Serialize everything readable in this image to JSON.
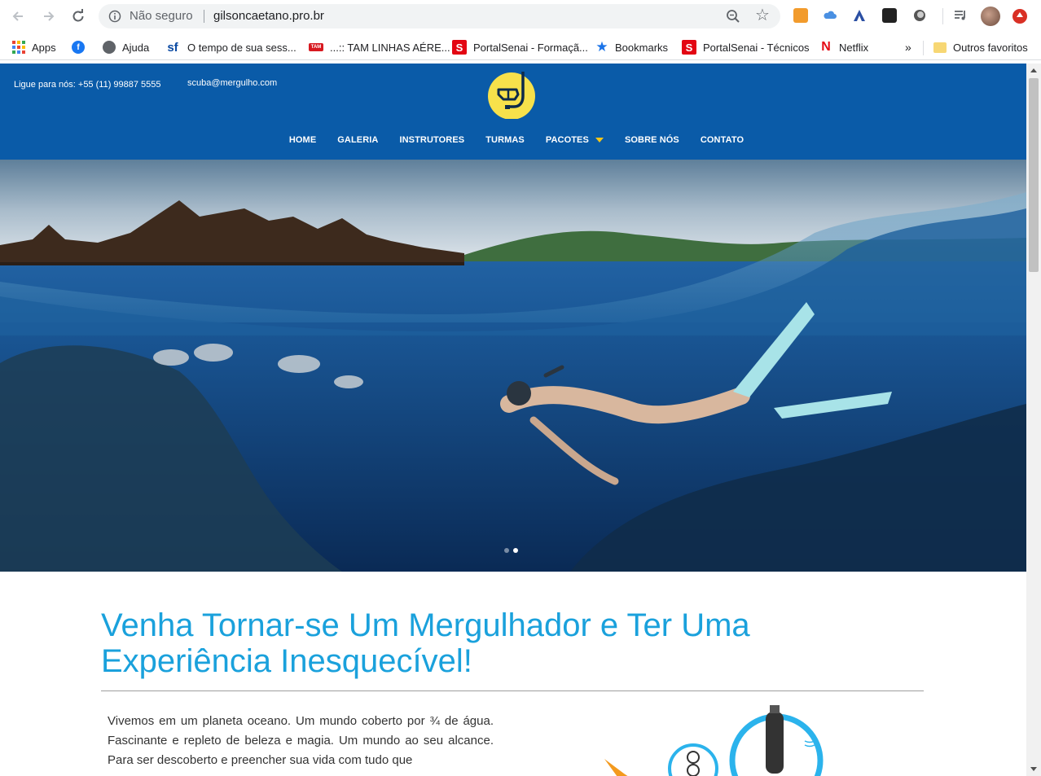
{
  "browser": {
    "security_label": "Não seguro",
    "url": "gilsoncaetano.pro.br",
    "bookmarks": [
      {
        "label": "Apps",
        "icon": "apps-grid-icon"
      },
      {
        "label": "",
        "icon": "facebook-icon"
      },
      {
        "label": "Ajuda",
        "icon": "globe-icon"
      },
      {
        "label": "O tempo de sua sess...",
        "icon": "sf-icon"
      },
      {
        "label": "...:: TAM LINHAS AÉRE...",
        "icon": "tam-icon"
      },
      {
        "label": "PortalSenai - Formaçã...",
        "icon": "senai-icon"
      },
      {
        "label": "Bookmarks",
        "icon": "star-icon"
      },
      {
        "label": "PortalSenai - Técnicos",
        "icon": "senai-icon"
      },
      {
        "label": "Netflix",
        "icon": "netflix-icon"
      }
    ],
    "overflow_label": "»",
    "other_bookmarks": "Outros favoritos"
  },
  "site": {
    "phone_text": "Ligue para nós: +55 (11) 99887 5555",
    "email_text": "scuba@mergulho.com",
    "menu": [
      "HOME",
      "GALERIA",
      "INSTRUTORES",
      "TURMAS",
      "PACOTES",
      "SOBRE NÓS",
      "CONTATO"
    ],
    "slider": {
      "slides": 2,
      "active": 2
    },
    "headline_line1": "Venha Tornar-se Um Mergulhador e Ter Uma",
    "headline_line2": "Experiência Inesquecível!",
    "intro_text": "Vivemos em um planeta oceano. Um mundo coberto por ¾ de água. Fascinante e repleto de beleza e magia. Um mundo ao seu alcance. Para ser descoberto e preencher sua vida com tudo que"
  },
  "colors": {
    "header_blue": "#0a5ba8",
    "headline_blue": "#1aa1dc",
    "logo_yellow": "#f7e14b",
    "caret_yellow": "#f5c518"
  }
}
